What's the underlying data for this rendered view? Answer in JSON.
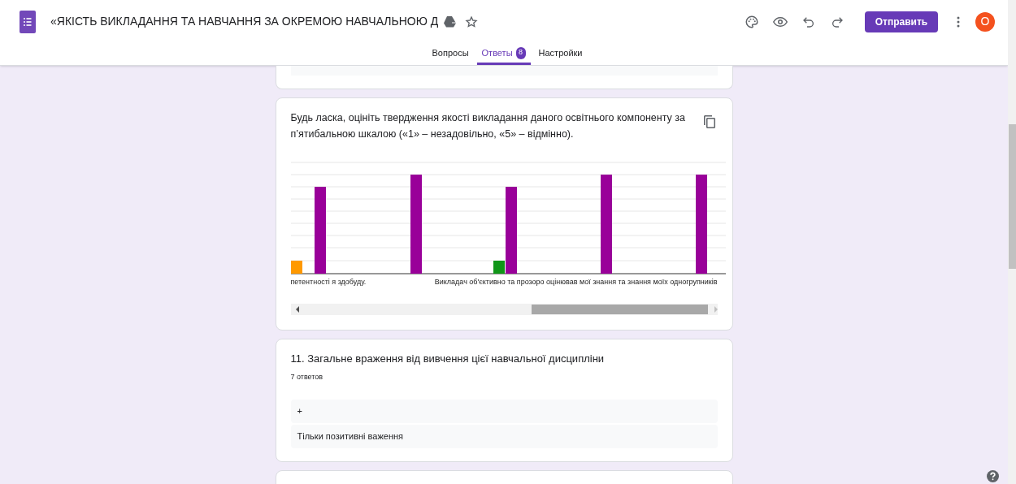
{
  "header": {
    "title": "«ЯКІСТЬ ВИКЛАДАННЯ ТА НАВЧАННЯ ЗА ОКРЕМОЮ НАВЧАЛЬНОЮ Д",
    "send_button": "Отправить",
    "avatar": "О"
  },
  "tabs": [
    {
      "label": "Вопросы",
      "selected": false
    },
    {
      "label": "Ответы",
      "selected": true,
      "badge": "8"
    },
    {
      "label": "Настройки",
      "selected": false
    }
  ],
  "cards": [
    {
      "kind": "partial"
    },
    {
      "kind": "chart",
      "question": "Будь ласка, оцініть твердження якості викладання даного освітнього компоненту за п’ятибальною шкалою («1» – незадовільно, «5» – відмінно).",
      "axis_labels": [
        "петентності я здобуду.",
        "Викладач об'єктивно та прозоро оцінював мої знання та знання моїх одногрупників"
      ]
    },
    {
      "kind": "text",
      "question": "11. Загальне враження від вивчення цієї навчальної дисципліни",
      "count": "7 ответов",
      "answers": [
        "+",
        "Тільки позитивні важення"
      ]
    },
    {
      "kind": "partial"
    }
  ]
}
